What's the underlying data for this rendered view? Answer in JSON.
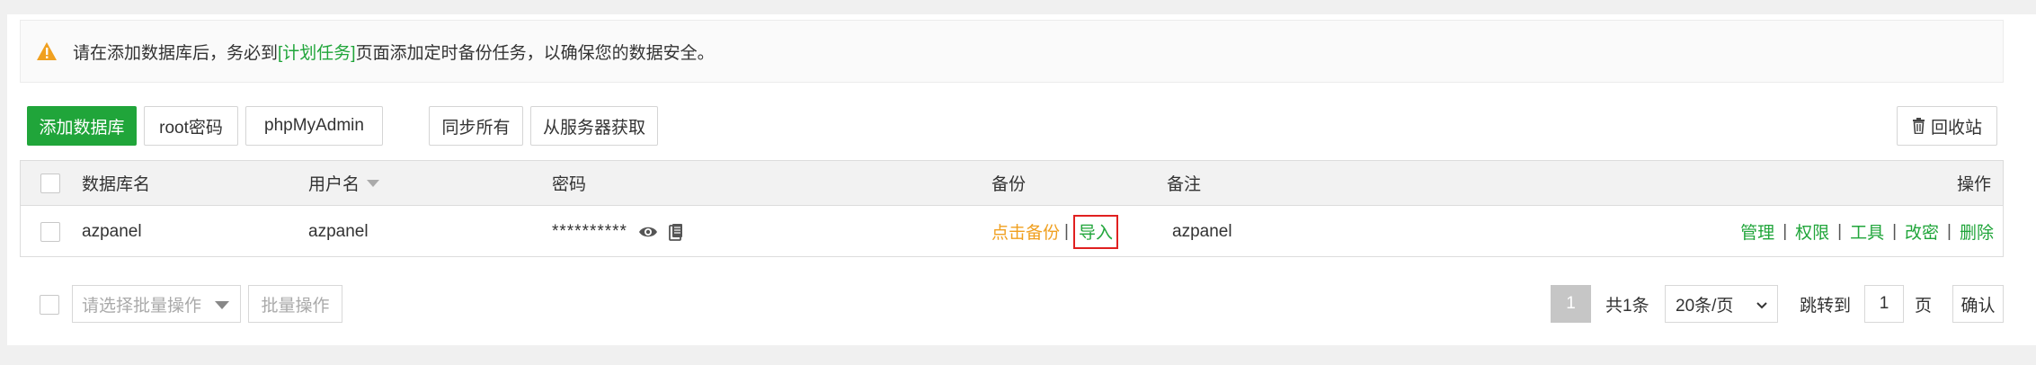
{
  "alert": {
    "text_before": "请在添加数据库后，务必到",
    "link": "[计划任务]",
    "text_after": "页面添加定时备份任务，以确保您的数据安全。"
  },
  "toolbar": {
    "add_db": "添加数据库",
    "root_pwd": "root密码",
    "phpmyadmin": "phpMyAdmin",
    "sync_all": "同步所有",
    "fetch_server": "从服务器获取",
    "recycle": "回收站"
  },
  "table": {
    "headers": {
      "name": "数据库名",
      "user": "用户名",
      "password": "密码",
      "backup": "备份",
      "remark": "备注",
      "actions": "操作"
    },
    "rows": [
      {
        "name": "azpanel",
        "user": "azpanel",
        "password": "**********",
        "backup_link": "点击备份",
        "import_link": "导入",
        "remark": "azpanel",
        "actions": [
          "管理",
          "权限",
          "工具",
          "改密",
          "删除"
        ]
      }
    ]
  },
  "footer": {
    "batch_placeholder": "请选择批量操作",
    "batch_button": "批量操作",
    "current_page": "1",
    "total": "共1条",
    "per_page": "20条/页",
    "jump_to": "跳转到",
    "jump_value": "1",
    "page_unit": "页",
    "confirm": "确认"
  },
  "colors": {
    "primary": "#20a53a",
    "warning": "#f0a020",
    "danger": "#e02020"
  }
}
